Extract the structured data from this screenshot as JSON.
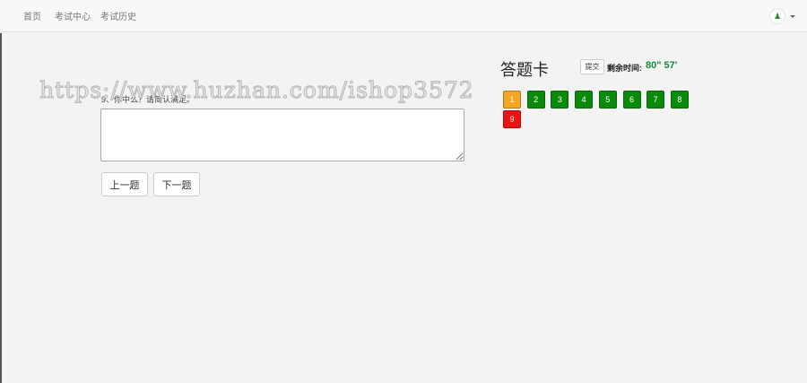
{
  "nav": {
    "items": [
      {
        "label": "首页"
      },
      {
        "label": "考试中心"
      },
      {
        "label": "考试历史"
      }
    ]
  },
  "user": {
    "avatar_icon": "user-avatar-icon"
  },
  "question": {
    "label": "9、你中么？请简认满足。",
    "answer_value": ""
  },
  "buttons": {
    "prev": "上一题",
    "next": "下一题"
  },
  "watermark": "https://www.huzhan.com/ishop3572",
  "answer_card": {
    "title": "答题卡",
    "submit": "提交",
    "time_label": "剩余时间:",
    "time_value": "80\" 57'",
    "questions": [
      {
        "num": "1",
        "status": "current"
      },
      {
        "num": "2",
        "status": "answered"
      },
      {
        "num": "3",
        "status": "answered"
      },
      {
        "num": "4",
        "status": "answered"
      },
      {
        "num": "5",
        "status": "answered"
      },
      {
        "num": "6",
        "status": "answered"
      },
      {
        "num": "7",
        "status": "answered"
      },
      {
        "num": "8",
        "status": "answered"
      },
      {
        "num": "9",
        "status": "unanswered"
      }
    ]
  },
  "colors": {
    "current": "#f5a623",
    "answered": "#0a8a0a",
    "unanswered": "#ee1111",
    "time": "#178a3c"
  }
}
